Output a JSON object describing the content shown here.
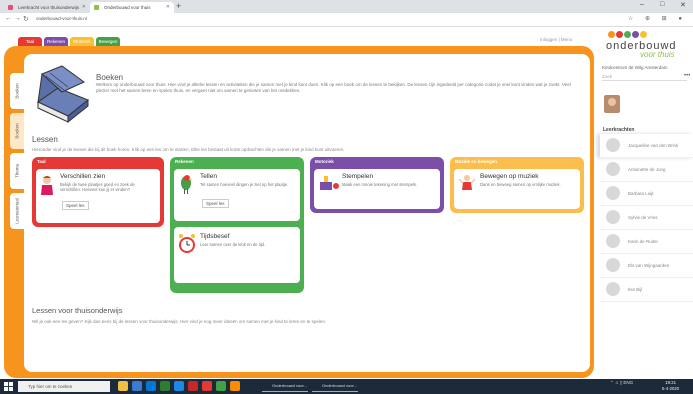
{
  "browser": {
    "tabs": [
      {
        "label": "Leerkracht voor thuisonderwijs",
        "fav_color": "#e94e77"
      },
      {
        "label": "Onderbouwd voor thuis",
        "fav_color": "#8bc34a"
      }
    ],
    "new_tab": "+",
    "url": "onderbouwd-voor-thuis.nl",
    "window_controls": [
      "–",
      "□",
      "✕"
    ]
  },
  "header": {
    "category_tabs": [
      {
        "label": "Taal",
        "color": "#e53935"
      },
      {
        "label": "Rekenen",
        "color": "#7b4fa8"
      },
      {
        "label": "Motoriek",
        "color": "#fbc02d"
      },
      {
        "label": "Bewegen",
        "color": "#43a047"
      }
    ],
    "top_links": "Inloggen | Menu"
  },
  "side_tabs": [
    "Boeken",
    "Boeken",
    "Thema",
    "Lesmateriaal"
  ],
  "book": {
    "title": "Boeken",
    "text": "Welkom op onderbouwd voor thuis. Hier vind je allerlei lessen en activiteiten die je samen met je kind kunt doen. Klik op een boek om de lessen te bekijken. De lessen zijn ingedeeld per categorie zodat je snel kunt vinden wat je zoekt. Veel plezier met het samen leren en spelen thuis, en vergeet niet om samen te genieten van het ontdekken."
  },
  "lessen": {
    "heading": "Lessen",
    "intro": "Hieronder vind je de lessen die bij dit boek horen. Klik op een les om te starten. Elke les bestaat uit korte opdrachten die je samen met je kind kunt uitvoeren.",
    "categories": [
      {
        "label": "Taal",
        "color": "#e53935",
        "cards": [
          {
            "title": "Verschillen zien",
            "desc": "Bekijk de twee plaatjes goed en zoek de verschillen. Hoeveel kun jij er vinden?",
            "button": "Speel les"
          }
        ]
      },
      {
        "label": "Rekenen",
        "color": "#4caf50",
        "cards": [
          {
            "title": "Tellen",
            "desc": "Tel samen hoeveel dingen je ziet op het plaatje.",
            "button": "Speel les"
          },
          {
            "title": "Tijdsbesef",
            "desc": "Leer samen over de klok en de tijd."
          }
        ]
      },
      {
        "label": "Motoriek",
        "color": "#7b4fa8",
        "cards": [
          {
            "title": "Stempelen",
            "desc": "Maak een mooie tekening met stempels."
          }
        ]
      },
      {
        "label": "Muziek en bewegen",
        "color": "#fbbd4b",
        "cards": [
          {
            "title": "Bewegen op muziek",
            "desc": "Dans en beweeg samen op vrolijke muziek."
          }
        ]
      }
    ]
  },
  "thuis": {
    "heading": "Lessen voor thuisonderwijs",
    "text": "Wil je ook een les geven? Kijk dan eens bij de lessen voor thuisonderwijs. Hier vind je nog meer ideeën om samen met je kind te leren en te spelen."
  },
  "right_panel": {
    "logo_top": "onderbouwd",
    "logo_bottom": "voor thuis",
    "logo_dots": [
      "#f7941d",
      "#e53935",
      "#4caf50",
      "#7b4fa8",
      "#fbc02d"
    ],
    "school": "Kindcentrum de Wilg Amsterdam",
    "search_placeholder": "Zoek",
    "more": "•••",
    "leerkrachten_title": "Leerkrachten",
    "leerkrachten": [
      "Jacqueline van den Brink",
      "Antoinette de Jong",
      "Barbara Luijt",
      "Sylvie de Vries",
      "Karin de Ruiter",
      "Els van Wijngaarden",
      "Ilse Bijl"
    ]
  },
  "taskbar": {
    "search": "Typ hier om te zoeken",
    "windows": [
      "Onderbouwd voor...",
      "Onderbouwd voor..."
    ],
    "clock_time": "19:21",
    "clock_date": "5-4-2020",
    "tray": "⌃ ♫ ▯ ENG"
  }
}
